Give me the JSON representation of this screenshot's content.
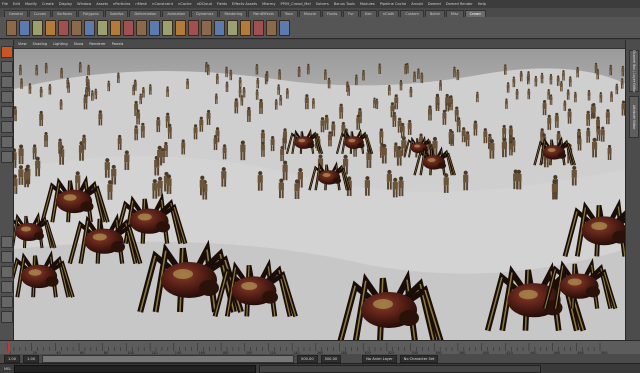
{
  "menus": [
    "File",
    "Edit",
    "Modify",
    "Create",
    "Display",
    "Window",
    "Assets",
    "nParticles",
    "nMesh",
    "nConstraint",
    "nCache",
    "nDCloud",
    "Fields",
    "Effects Assets",
    "Miarmy",
    "PP09_Crowd_Mel",
    "Solvers",
    "Bonus Tools",
    "Modules",
    "Pipeline Cache",
    "Arnold",
    "Domed",
    "Domed Render",
    "Help"
  ],
  "shelf_tabs": [
    "General",
    "Curves",
    "Surfaces",
    "Polygons",
    "Subdivs",
    "Deformation",
    "Animation",
    "Dynamics",
    "Rendering",
    "PaintEffects",
    "Toon",
    "Muscle",
    "Fluids",
    "Fur",
    "Hair",
    "nCloth",
    "Custom",
    "Bullet",
    "Misc",
    "Crowd"
  ],
  "active_shelf": "Crowd",
  "panel_menu": [
    "View",
    "Shading",
    "Lighting",
    "Show",
    "Renderer",
    "Panels"
  ],
  "channel_tabs": [
    "Channel Box / Layer Editor",
    "Attribute Editor"
  ],
  "range": {
    "start": "1.00",
    "start_inner": "1.00",
    "end_inner": "500.00",
    "end": "500.00",
    "current": "1.00"
  },
  "anim_layer": "No Anim Layer",
  "character_set": "No Character Set",
  "command_label": "MEL",
  "timeline_ticks": [
    "1",
    "20",
    "40",
    "60",
    "80",
    "100",
    "120",
    "140",
    "160",
    "180",
    "200",
    "220",
    "240",
    "260",
    "280",
    "300",
    "320",
    "340",
    "360",
    "380",
    "400",
    "420",
    "440",
    "460",
    "480",
    "500"
  ],
  "icons": {
    "select_tool": "arrow-select-icon",
    "lasso_tool": "lasso-icon",
    "move_tool": "move-icon",
    "rotate_tool": "rotate-icon",
    "scale_tool": "scale-icon",
    "play": "play-icon"
  },
  "colors": {
    "accent": "#cc5522",
    "viewport_bg": "#b9b9b9"
  }
}
